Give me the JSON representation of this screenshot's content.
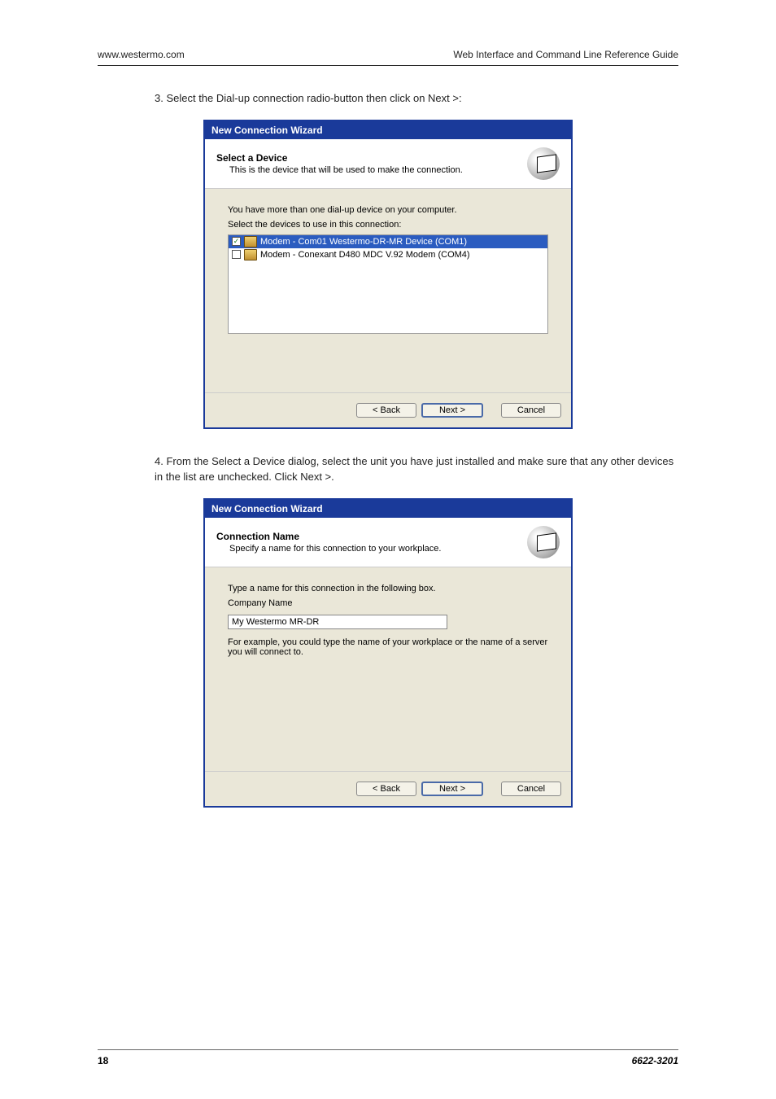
{
  "header": {
    "left": "www.westermo.com",
    "right": "Web Interface and Command Line Reference Guide"
  },
  "step3": {
    "text": "3. Select the Dial-up connection radio-button then click on Next >:",
    "wizard_title": "New Connection Wizard",
    "panel_title": "Select a Device",
    "panel_sub": "This is the device that will be used to make the connection.",
    "body_line1": "You have more than one dial-up device on your computer.",
    "body_line2": "Select the devices to use in this connection:",
    "devices": [
      {
        "checked": true,
        "selected": true,
        "label": "Modem - Com01 Westermo-DR-MR Device (COM1)"
      },
      {
        "checked": false,
        "selected": false,
        "label": "Modem - Conexant D480 MDC V.92 Modem (COM4)"
      }
    ],
    "buttons": {
      "back": "< Back",
      "next": "Next >",
      "cancel": "Cancel"
    }
  },
  "step4": {
    "text": "4. From the Select a Device dialog, select the unit you have just installed and make sure that any other devices in the list are unchecked. Click Next >.",
    "wizard_title": "New Connection Wizard",
    "panel_title": "Connection Name",
    "panel_sub": "Specify a name for this connection to your workplace.",
    "body_line1": "Type a name for this connection in the following box.",
    "company_label": "Company Name",
    "input_value": "My Westermo MR-DR",
    "example": "For example, you could type the name of your workplace or the name of a server you will connect to.",
    "buttons": {
      "back": "< Back",
      "next": "Next >",
      "cancel": "Cancel"
    }
  },
  "footer": {
    "page_number": "18",
    "doc_ref": "6622-3201"
  }
}
